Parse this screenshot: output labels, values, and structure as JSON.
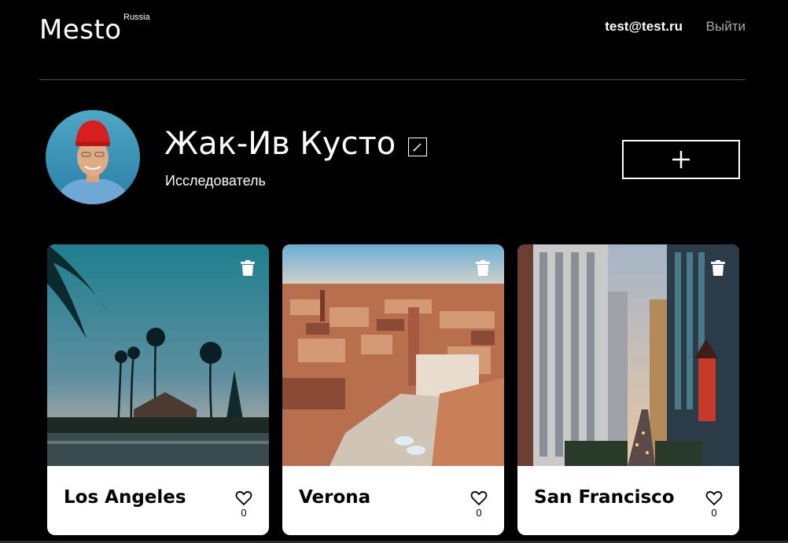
{
  "header": {
    "logo": "Mesto",
    "region": "Russia",
    "user_email": "test@test.ru",
    "logout_label": "Выйти"
  },
  "profile": {
    "name": "Жак-Ив Кусто",
    "about": "Исследователь",
    "add_label": "+"
  },
  "cards": [
    {
      "title": "Los Angeles",
      "likes": "0"
    },
    {
      "title": "Verona",
      "likes": "0"
    },
    {
      "title": "San Francisco",
      "likes": "0"
    }
  ],
  "colors": {
    "background": "#000000",
    "card": "#ffffff",
    "divider": "#545454",
    "logout": "#a9a9a9"
  }
}
